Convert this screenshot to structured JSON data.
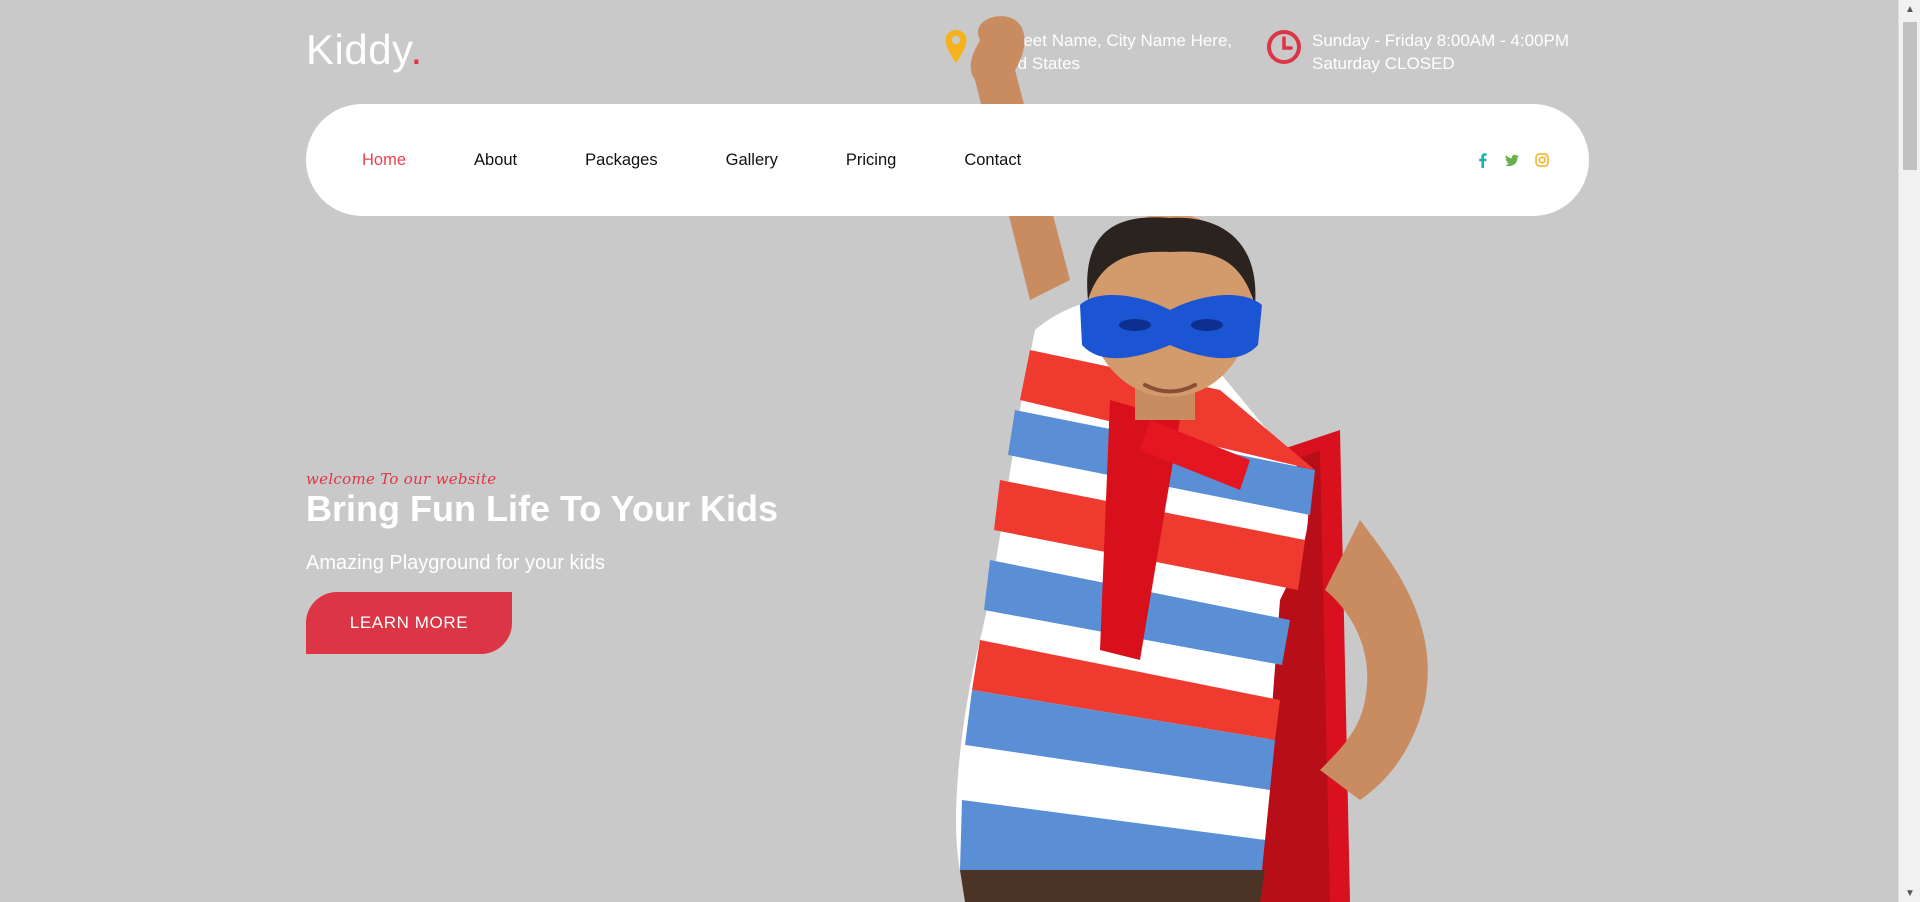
{
  "brand": {
    "name": "Kiddy",
    "dot": "."
  },
  "header": {
    "address": "34 Street Name, City Name Here, United States",
    "hours": "Sunday - Friday 8:00AM - 4:00PM Saturday CLOSED"
  },
  "nav": {
    "items": [
      {
        "label": "Home",
        "active": true
      },
      {
        "label": "About",
        "active": false
      },
      {
        "label": "Packages",
        "active": false
      },
      {
        "label": "Gallery",
        "active": false
      },
      {
        "label": "Pricing",
        "active": false
      },
      {
        "label": "Contact",
        "active": false
      }
    ],
    "socials": [
      "facebook-icon",
      "twitter-icon",
      "instagram-icon"
    ]
  },
  "hero": {
    "tagline": "welcome To our website",
    "title": "Bring Fun Life To Your Kids",
    "subtitle": "Amazing Playground for your kids",
    "cta": "LEARN MORE"
  },
  "colors": {
    "background": "#c9c9c9",
    "accent": "#dc3545",
    "location_icon": "#f6b21b",
    "facebook": "#1ab1a9",
    "twitter": "#6ab04c",
    "instagram": "#f6b21b"
  }
}
